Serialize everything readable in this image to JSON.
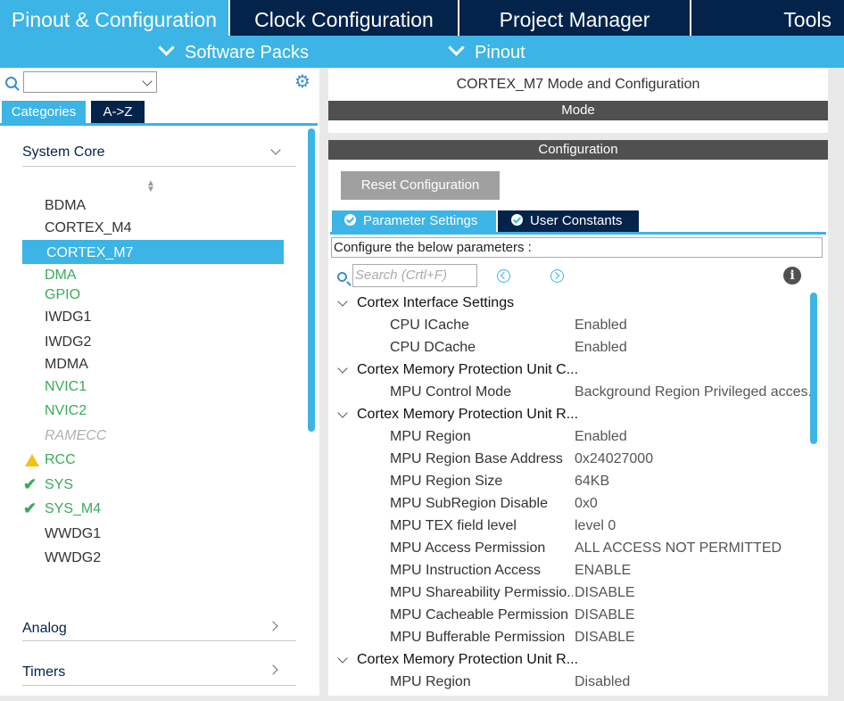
{
  "top_tabs": [
    "Pinout & Configuration",
    "Clock Configuration",
    "Project Manager",
    "Tools"
  ],
  "sub_menus": [
    "Software Packs",
    "Pinout"
  ],
  "left": {
    "category_tabs": [
      "Categories",
      "A->Z"
    ],
    "sections": {
      "system_core": "System Core",
      "analog": "Analog",
      "timers": "Timers"
    },
    "items": [
      "BDMA",
      "CORTEX_M4",
      "CORTEX_M7",
      "DMA",
      "GPIO",
      "IWDG1",
      "IWDG2",
      "MDMA",
      "NVIC1",
      "NVIC2",
      "RAMECC",
      "RCC",
      "SYS",
      "SYS_M4",
      "WWDG1",
      "WWDG2"
    ],
    "selected": "CORTEX_M7"
  },
  "right": {
    "title": "CORTEX_M7 Mode and Configuration",
    "mode_header": "Mode",
    "config_header": "Configuration",
    "reset_button": "Reset Configuration",
    "tabs": [
      "Parameter Settings",
      "User Constants"
    ],
    "configure_text": "Configure the below parameters :",
    "search_placeholder": "Search (Crtl+F)",
    "groups": [
      "Cortex Interface Settings",
      "Cortex Memory Protection Unit C...",
      "Cortex Memory Protection Unit R...",
      "Cortex Memory Protection Unit R..."
    ],
    "params": [
      {
        "name": "CPU ICache",
        "value": "Enabled"
      },
      {
        "name": "CPU DCache",
        "value": "Enabled"
      },
      {
        "name": "MPU Control Mode",
        "value": "Background Region Privileged acces..."
      },
      {
        "name": "MPU Region",
        "value": "Enabled"
      },
      {
        "name": "MPU Region Base Address",
        "value": "0x24027000"
      },
      {
        "name": "MPU Region Size",
        "value": "64KB"
      },
      {
        "name": "MPU SubRegion Disable",
        "value": "0x0"
      },
      {
        "name": "MPU TEX field level",
        "value": "level 0"
      },
      {
        "name": "MPU Access Permission",
        "value": "ALL ACCESS NOT PERMITTED"
      },
      {
        "name": "MPU Instruction Access",
        "value": "ENABLE"
      },
      {
        "name": "MPU Shareability Permissio...",
        "value": "DISABLE"
      },
      {
        "name": "MPU Cacheable Permission",
        "value": "DISABLE"
      },
      {
        "name": "MPU Bufferable  Permission",
        "value": "DISABLE"
      },
      {
        "name": "MPU Region",
        "value": "Disabled"
      }
    ]
  },
  "colors": {
    "navy": "#03234b",
    "accent": "#3cb4e6",
    "green": "#3aaa5a",
    "warning": "#f2c20f"
  }
}
